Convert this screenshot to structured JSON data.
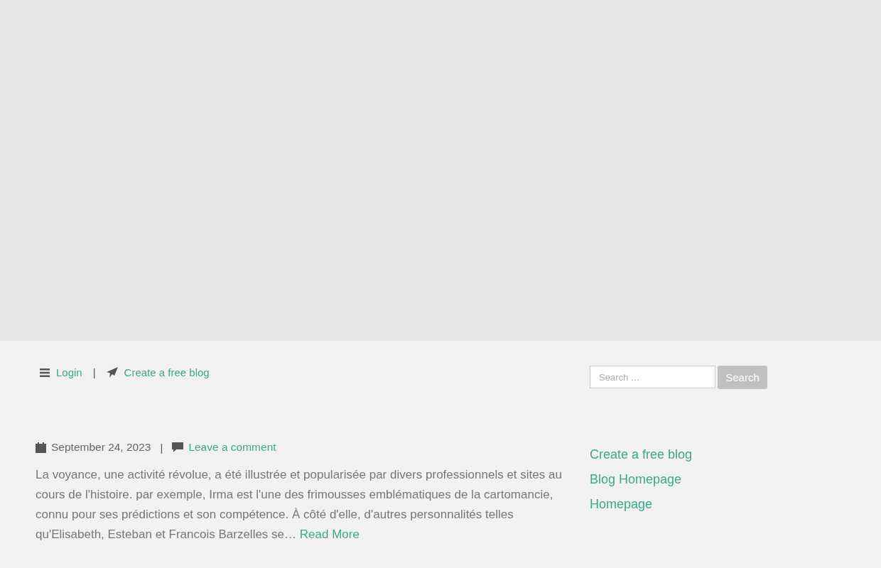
{
  "top_bar": {
    "login": "Login",
    "separator": "|",
    "create_blog": "Create a free blog"
  },
  "search": {
    "placeholder": "Search …",
    "button": "Search"
  },
  "post": {
    "date": "September 24, 2023",
    "separator": "|",
    "comment_link": "Leave a comment",
    "excerpt": "La voyance, une activité révolue, a été illustrée et popularisée par divers professionnels et sites au cours de l'histoire. par exemple, Irma est l'une des frimousses emblématiques de la cartomancie, connu pour ses prédictions et son compétence. À côté d'elle, d'autres personnalités telles qu'Elisabeth, Esteban et Francois Barzelles se…",
    "read_more": "Read More"
  },
  "sidebar": {
    "links": [
      "Create a free blog",
      "Blog Homepage",
      "Homepage"
    ]
  }
}
